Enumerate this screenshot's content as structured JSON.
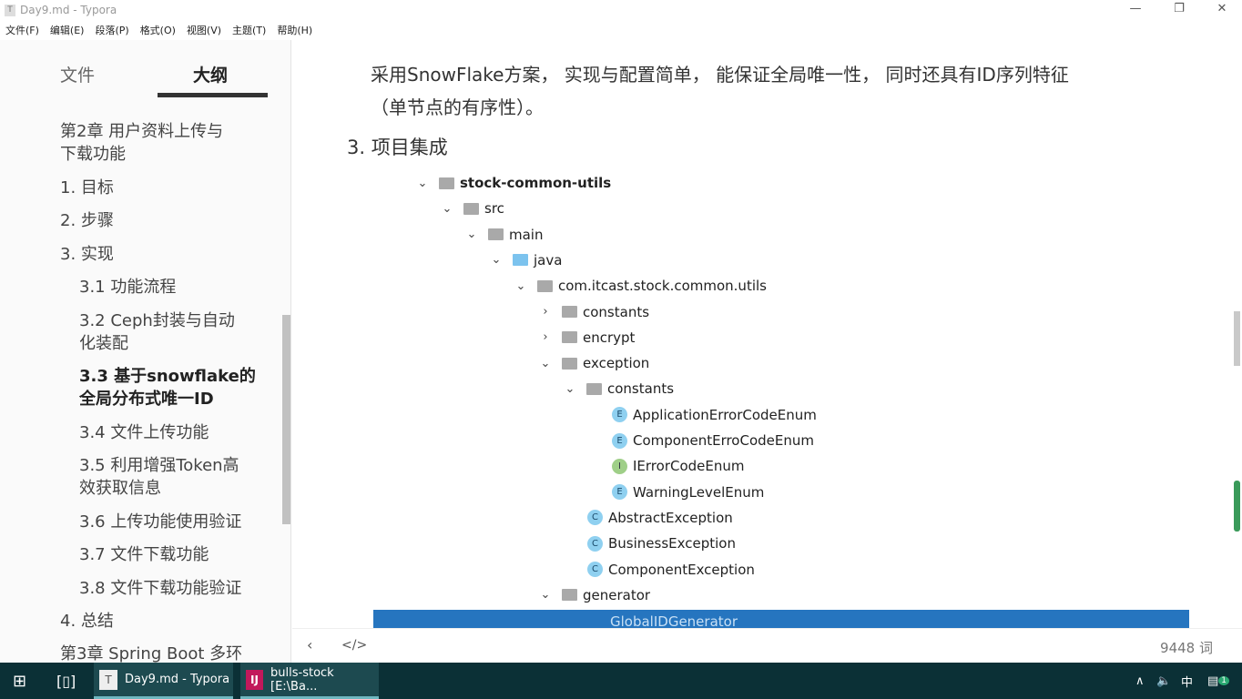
{
  "window": {
    "title": "Day9.md - Typora",
    "app_icon": "T"
  },
  "menu": [
    "文件(F)",
    "编辑(E)",
    "段落(P)",
    "格式(O)",
    "视图(V)",
    "主题(T)",
    "帮助(H)"
  ],
  "sidebar": {
    "tabs": [
      "文件",
      "大纲"
    ],
    "active_tab": "大纲",
    "outline": [
      {
        "label": "第2章 用户资料上传与",
        "level": 1
      },
      {
        "label": "下载功能",
        "level": 1
      },
      {
        "label": "1. 目标",
        "level": 1
      },
      {
        "label": "2. 步骤",
        "level": 1
      },
      {
        "label": "3. 实现",
        "level": 1
      },
      {
        "label": "3.1 功能流程",
        "level": 2
      },
      {
        "label": "3.2 Ceph封装与自动",
        "level": 2
      },
      {
        "label": "化装配",
        "level": 2
      },
      {
        "label": "3.3 基于snowflake的",
        "level": 2,
        "active": true
      },
      {
        "label": "全局分布式唯一ID",
        "level": 2,
        "active": true
      },
      {
        "label": "3.4 文件上传功能",
        "level": 2
      },
      {
        "label": "3.5 利用增强Token高",
        "level": 2
      },
      {
        "label": "效获取信息",
        "level": 2
      },
      {
        "label": "3.6 上传功能使用验证",
        "level": 2
      },
      {
        "label": "3.7 文件下载功能",
        "level": 2
      },
      {
        "label": "3.8 文件下载功能验证",
        "level": 2
      },
      {
        "label": "4. 总结",
        "level": 1
      },
      {
        "label": "第3章 Spring Boot 多环",
        "level": 1
      }
    ]
  },
  "content": {
    "para_line1": "采用SnowFlake方案， 实现与配置简单， 能保证全局唯一性， 同时还具有ID序列特征",
    "para_line2": "（单节点的有序性）。",
    "heading": "3. 项目集成",
    "tree": [
      {
        "label": "stock-common-utils",
        "depth": 0,
        "chevron": "down",
        "icon": "module",
        "bold": true
      },
      {
        "label": "src",
        "depth": 1,
        "chevron": "down",
        "icon": "folder"
      },
      {
        "label": "main",
        "depth": 2,
        "chevron": "down",
        "icon": "folder"
      },
      {
        "label": "java",
        "depth": 3,
        "chevron": "down",
        "icon": "folder-blue"
      },
      {
        "label": "com.itcast.stock.common.utils",
        "depth": 4,
        "chevron": "down",
        "icon": "package"
      },
      {
        "label": "constants",
        "depth": 5,
        "chevron": "right",
        "icon": "package"
      },
      {
        "label": "encrypt",
        "depth": 5,
        "chevron": "right",
        "icon": "package"
      },
      {
        "label": "exception",
        "depth": 5,
        "chevron": "down",
        "icon": "package"
      },
      {
        "label": "constants",
        "depth": 6,
        "chevron": "down",
        "icon": "package"
      },
      {
        "label": "ApplicationErrorCodeEnum",
        "depth": 7,
        "icon": "E"
      },
      {
        "label": "ComponentErroCodeEnum",
        "depth": 7,
        "icon": "E"
      },
      {
        "label": "IErrorCodeEnum",
        "depth": 7,
        "icon": "I"
      },
      {
        "label": "WarningLevelEnum",
        "depth": 7,
        "icon": "E"
      },
      {
        "label": "AbstractException",
        "depth": 6,
        "icon": "C"
      },
      {
        "label": "BusinessException",
        "depth": 6,
        "icon": "C"
      },
      {
        "label": "ComponentException",
        "depth": 6,
        "icon": "C"
      },
      {
        "label": "generator",
        "depth": 5,
        "chevron": "down",
        "icon": "package"
      }
    ],
    "selected_item": "GlobalIDGenerator"
  },
  "statusbar": {
    "word_count": "9448 词"
  },
  "taskbar": {
    "apps": [
      {
        "label": "Day9.md - Typora",
        "icon": "T"
      },
      {
        "label": "bulls-stock [E:\\Ba...",
        "icon": "IJ"
      }
    ],
    "ime": "中",
    "notifications": "1"
  }
}
